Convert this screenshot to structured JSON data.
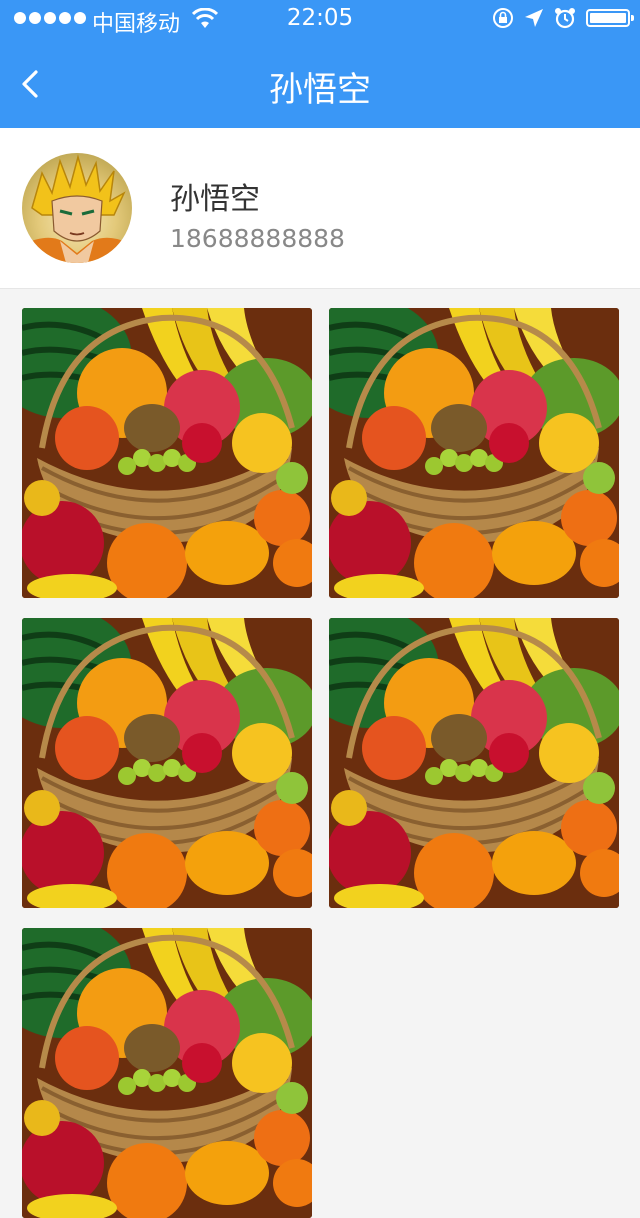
{
  "status_bar": {
    "carrier": "中国移动",
    "time": "22:05"
  },
  "nav": {
    "title": "孙悟空"
  },
  "profile": {
    "name": "孙悟空",
    "phone": "18688888888"
  },
  "photos": [
    {
      "subject": "fruit-basket"
    },
    {
      "subject": "fruit-basket"
    },
    {
      "subject": "fruit-basket"
    },
    {
      "subject": "fruit-basket"
    },
    {
      "subject": "fruit-basket"
    }
  ]
}
